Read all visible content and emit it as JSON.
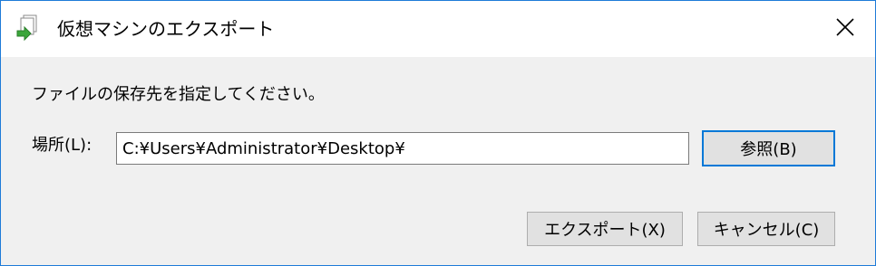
{
  "window": {
    "title": "仮想マシンのエクスポート",
    "title_icon": "vm-export-icon",
    "close_icon": "close-icon"
  },
  "dialog": {
    "prompt": "ファイルの保存先を指定してください。",
    "location_label": "場所(L):",
    "location_value": "C:¥Users¥Administrator¥Desktop¥",
    "browse_label": "参照(B)",
    "export_label": "エクスポート(X)",
    "cancel_label": "キャンセル(C)"
  },
  "colors": {
    "accent_border": "#0078d7",
    "window_border": "#1e7bd8",
    "client_background": "#f0f0f0",
    "button_face": "#e1e1e1"
  }
}
